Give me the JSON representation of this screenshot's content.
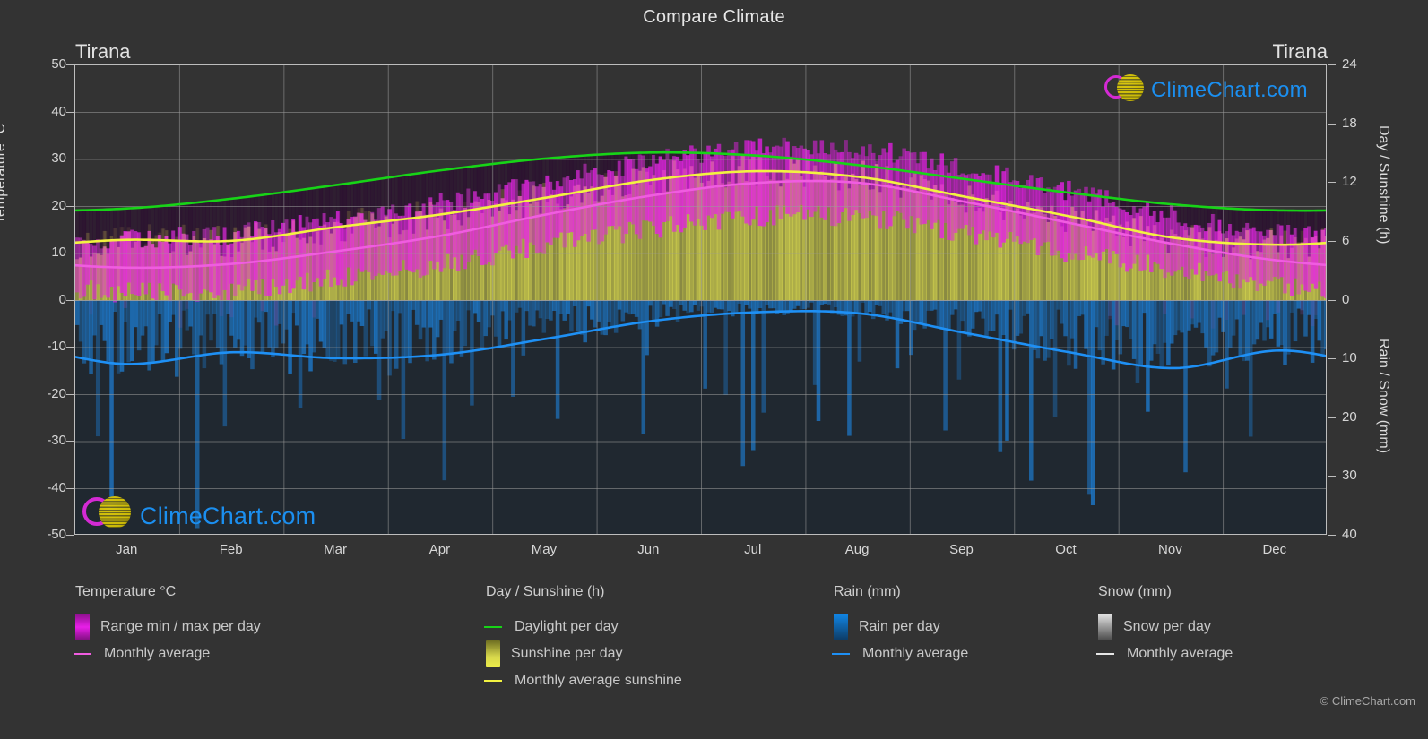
{
  "header": {
    "title": "Compare Climate",
    "city_left": "Tirana",
    "city_right": "Tirana"
  },
  "axes": {
    "left_title": "Temperature °C",
    "left_ticks": [
      "50",
      "40",
      "30",
      "20",
      "10",
      "0",
      "-10",
      "-20",
      "-30",
      "-40",
      "-50"
    ],
    "right_top_title": "Day / Sunshine (h)",
    "right_top_ticks": [
      "24",
      "18",
      "12",
      "6",
      "0"
    ],
    "right_bottom_title": "Rain / Snow (mm)",
    "right_bottom_ticks": [
      "0",
      "10",
      "20",
      "30",
      "40"
    ],
    "x_ticks": [
      "Jan",
      "Feb",
      "Mar",
      "Apr",
      "May",
      "Jun",
      "Jul",
      "Aug",
      "Sep",
      "Oct",
      "Nov",
      "Dec"
    ]
  },
  "legend": {
    "temperature": {
      "title": "Temperature °C",
      "range_label": "Range min / max per day",
      "average_label": "Monthly average",
      "range_color": "#e81fe8",
      "average_color": "#f05ce0"
    },
    "day_sunshine": {
      "title": "Day / Sunshine (h)",
      "daylight_label": "Daylight per day",
      "sunshine_label": "Sunshine per day",
      "avg_sunshine_label": "Monthly average sunshine",
      "daylight_color": "#17d417",
      "sunshine_color": "#eded4a",
      "avg_sunshine_color": "#f2f241"
    },
    "rain": {
      "title": "Rain (mm)",
      "per_day_label": "Rain per day",
      "average_label": "Monthly average",
      "per_day_color": "#1187e8",
      "average_color": "#1e90f5"
    },
    "snow": {
      "title": "Snow (mm)",
      "per_day_label": "Snow per day",
      "average_label": "Monthly average",
      "per_day_color": "#e6e6e6",
      "average_color": "#e6e6e6"
    }
  },
  "watermark": {
    "text": "ClimeChart.com",
    "ring_color": "#d42ad4",
    "ball_color": "#e3d92b",
    "text_color": "#1b8ff0"
  },
  "copyright": "© ClimeChart.com",
  "colors": {
    "background": "#333333",
    "grid": "#8d8d8d",
    "axis": "#bdbdbd",
    "text": "#d5d5d5"
  },
  "chart_data": {
    "type": "line",
    "title": "Compare Climate",
    "subtitle": "Tirana",
    "xlabel": "",
    "ylabel": "Temperature °C",
    "grid": true,
    "legend_position": "bottom",
    "x": [
      "Jan",
      "Feb",
      "Mar",
      "Apr",
      "May",
      "Jun",
      "Jul",
      "Aug",
      "Sep",
      "Oct",
      "Nov",
      "Dec"
    ],
    "axis_left": {
      "label": "Temperature °C",
      "range": [
        -50,
        50
      ],
      "tick_step": 10
    },
    "axis_right_top": {
      "label": "Day / Sunshine (h)",
      "range": [
        0,
        24
      ],
      "tick_step": 6
    },
    "axis_right_bottom": {
      "label": "Rain / Snow (mm)",
      "range": [
        0,
        40
      ],
      "tick_step": 10
    },
    "series": [
      {
        "name": "Monthly average temperature",
        "unit": "°C",
        "axis": "left",
        "color": "#f05ce0",
        "values": [
          7.0,
          7.8,
          10.5,
          13.8,
          18.3,
          22.3,
          25.0,
          25.0,
          21.0,
          16.5,
          12.0,
          8.5
        ]
      },
      {
        "name": "Monthly average sunshine",
        "unit": "h",
        "axis": "right_top",
        "color": "#f2f241",
        "values": [
          6.2,
          6.1,
          7.5,
          8.8,
          10.5,
          12.3,
          13.2,
          12.6,
          10.6,
          8.6,
          6.4,
          5.7
        ]
      },
      {
        "name": "Daylight per day",
        "unit": "h",
        "axis": "right_top",
        "color": "#17d417",
        "values": [
          9.4,
          10.4,
          11.8,
          13.3,
          14.5,
          15.1,
          14.8,
          13.8,
          12.4,
          11.0,
          9.8,
          9.2
        ]
      },
      {
        "name": "Monthly average rain",
        "unit": "mm",
        "axis": "right_bottom",
        "color": "#1e90f5",
        "values": [
          10.8,
          8.8,
          9.8,
          9.2,
          6.5,
          3.5,
          2.0,
          2.2,
          5.5,
          8.8,
          11.5,
          8.5
        ]
      },
      {
        "name": "Daily max temperature",
        "unit": "°C",
        "axis": "left",
        "color": "#e81fe8",
        "values": [
          13.0,
          14.0,
          17.0,
          20.5,
          25.0,
          29.5,
          32.0,
          32.0,
          28.0,
          23.0,
          18.0,
          14.0
        ]
      },
      {
        "name": "Daily min temperature",
        "unit": "°C",
        "axis": "left",
        "color": "#e81fe8",
        "values": [
          2.0,
          2.5,
          5.0,
          8.0,
          12.0,
          15.5,
          18.0,
          18.0,
          14.5,
          10.5,
          7.0,
          3.5
        ]
      }
    ]
  }
}
